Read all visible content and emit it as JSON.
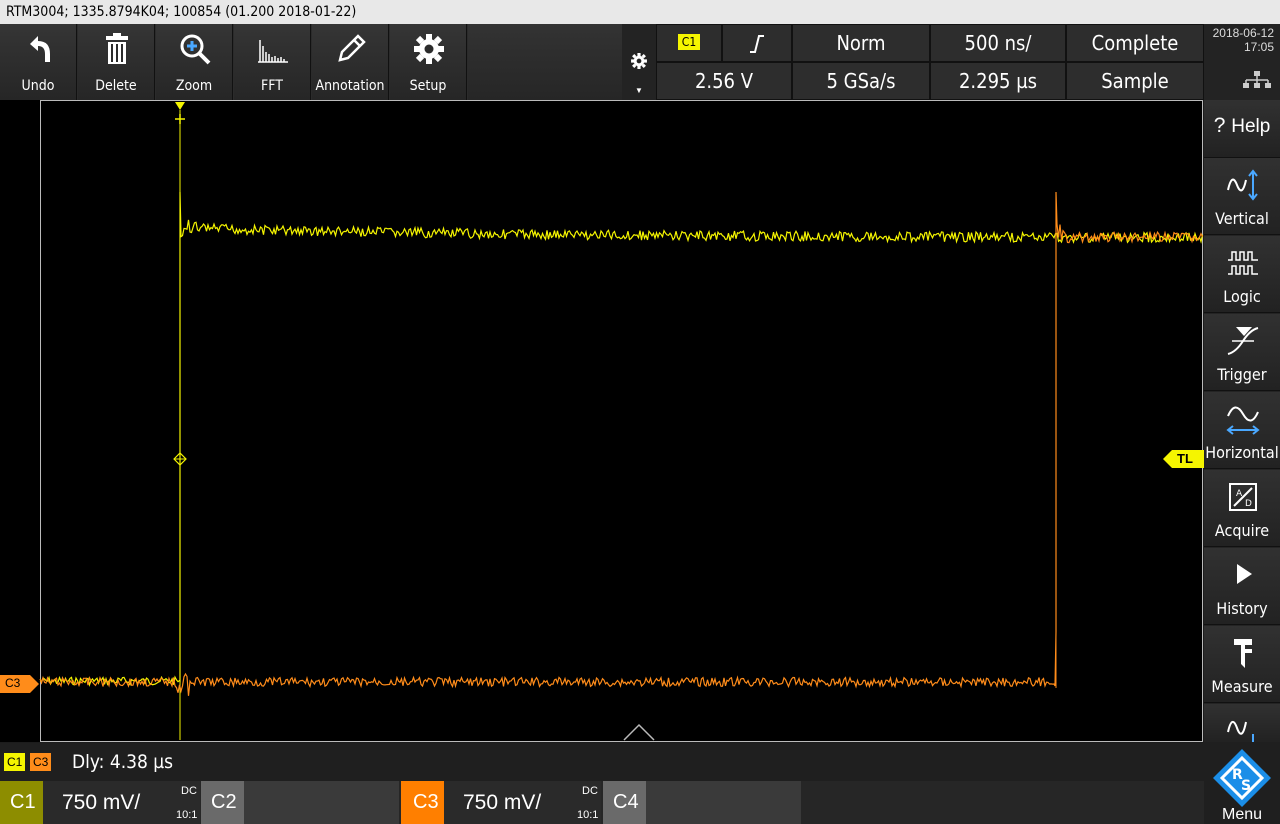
{
  "window": {
    "title": "RTM3004; 1335.8794K04; 100854 (01.200 2018-01-22)"
  },
  "toolbar": {
    "items": [
      {
        "label": "Undo",
        "icon": "undo-icon"
      },
      {
        "label": "Delete",
        "icon": "trash-icon"
      },
      {
        "label": "Zoom",
        "icon": "zoom-icon"
      },
      {
        "label": "FFT",
        "icon": "fft-icon"
      },
      {
        "label": "Annotation",
        "icon": "pencil-icon"
      },
      {
        "label": "Setup",
        "icon": "gear-icon"
      }
    ]
  },
  "trigger": {
    "source": "C1",
    "level": "2.56 V",
    "mode": "Norm",
    "sample_rate": "5 GSa/s",
    "timebase": "500 ns/",
    "position": "2.295 µs",
    "acq_status": "Complete",
    "acq_mode": "Sample"
  },
  "datetime": {
    "date": "2018-06-12",
    "time": "17:05"
  },
  "sidebar": {
    "items": [
      {
        "label": "Help",
        "prefix": "?"
      },
      {
        "label": "Vertical"
      },
      {
        "label": "Logic"
      },
      {
        "label": "Trigger"
      },
      {
        "label": "Horizontal"
      },
      {
        "label": "Acquire"
      },
      {
        "label": "History"
      },
      {
        "label": "Measure"
      }
    ],
    "menu_label": "Menu"
  },
  "markers": {
    "trigger_level": "TL",
    "c3_marker": "C3"
  },
  "status": {
    "c1": "C1",
    "c3": "C3",
    "delay": "Dly: 4.38 µs"
  },
  "channels": [
    {
      "name": "C1",
      "scale": "750 mV/",
      "coupling": "DC",
      "probe": "10:1",
      "active": true,
      "color": "#f5f500"
    },
    {
      "name": "C2",
      "scale": "",
      "coupling": "",
      "probe": "",
      "active": false,
      "color": "#888888"
    },
    {
      "name": "C3",
      "scale": "750 mV/",
      "coupling": "DC",
      "probe": "10:1",
      "active": true,
      "color": "#ff8000"
    },
    {
      "name": "C4",
      "scale": "",
      "coupling": "",
      "probe": "",
      "active": false,
      "color": "#888888"
    }
  ],
  "colors": {
    "c1": "#f5f500",
    "c3": "#ff8c1a"
  }
}
